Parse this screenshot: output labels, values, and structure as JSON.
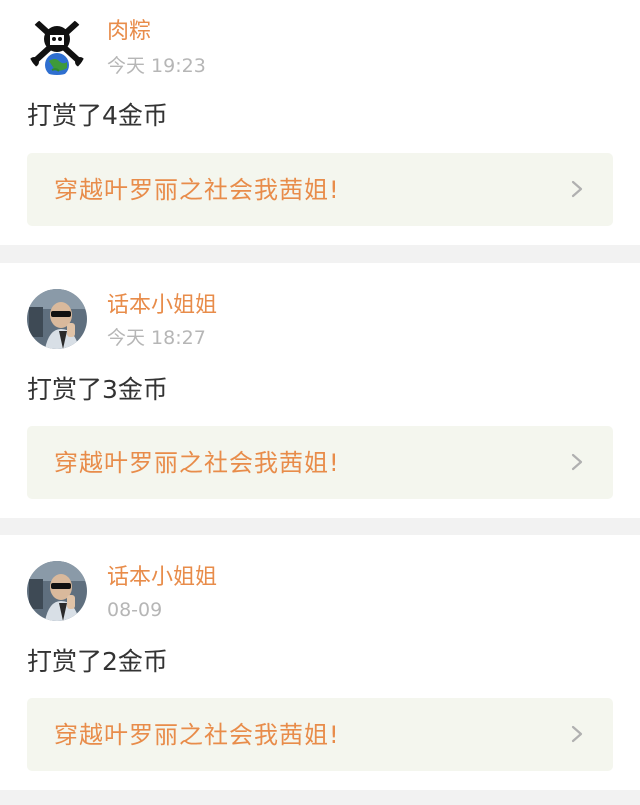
{
  "feed": [
    {
      "user": "肉粽",
      "time": "今天 19:23",
      "reward": "打赏了4金币",
      "book": "穿越叶罗丽之社会我茜姐!",
      "avatar": "skull-crossbones-globe"
    },
    {
      "user": "话本小姐姐",
      "time": "今天 18:27",
      "reward": "打赏了3金币",
      "book": "穿越叶罗丽之社会我茜姐!",
      "avatar": "person-with-sunglasses"
    },
    {
      "user": "话本小姐姐",
      "time": "08-09",
      "reward": "打赏了2金币",
      "book": "穿越叶罗丽之社会我茜姐!",
      "avatar": "person-with-sunglasses"
    }
  ],
  "colors": {
    "accent": "#e88c4a",
    "muted": "#b6b6b6",
    "link_bg": "#f4f6ee",
    "separator": "#f2f2f2"
  }
}
